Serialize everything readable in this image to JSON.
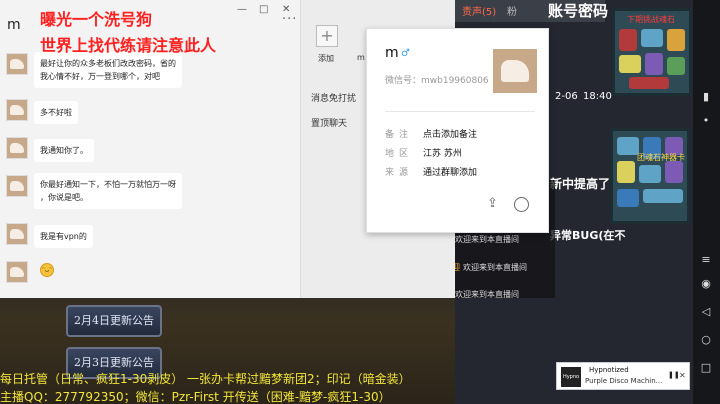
{
  "overlay": {
    "line1": "曝光一个洗号狗",
    "line2": "世界上找代练请注意此人"
  },
  "chat": {
    "contact_name": "m",
    "window_controls": [
      "—",
      "□",
      "✕"
    ],
    "more": "···",
    "messages": [
      {
        "lines": [
          "最好让你的众多老板们改改密码，省的",
          "我心情不好，万一登到哪个，对吧"
        ]
      },
      {
        "lines": [
          "多不好啦"
        ]
      },
      {
        "lines": [
          "我通知你了。"
        ]
      },
      {
        "lines": [
          "你最好通知一下，不怕一万就怕万一呀",
          "，你说是吧。"
        ]
      },
      {
        "lines": [
          "我是有vpn的"
        ]
      }
    ],
    "emoji": "😄"
  },
  "side": {
    "add_label": "添加",
    "member_label": "m",
    "mute_label": "消息免打扰",
    "pin_label": "置顶聊天"
  },
  "profile": {
    "name": "m",
    "gender_icon": "male-icon",
    "wechat_id": "微信号：mwb19960806",
    "rows": [
      {
        "key": "备注",
        "value": "点击添加备注"
      },
      {
        "key": "地区",
        "value": "江苏 苏州"
      },
      {
        "key": "来源",
        "value": "通过群聊添加"
      }
    ]
  },
  "game": {
    "tab_active": "责声(5)",
    "tab_other": "粉",
    "password_title": "账号密码",
    "date_a": "2-06",
    "date_b": "18:40",
    "text_a": "新中提高了",
    "text_b": "异常BUG(在不",
    "chat_lines": [
      "欢迎来到本直播间",
      "欢迎来到本直播间",
      "欢迎来到本直播间",
      "欢迎来到本直播间"
    ],
    "chat_highlight": "迎",
    "puzzle1_label": "下期挑战魂石",
    "puzzle2_label": "团魂石神器卡",
    "announce1": "2月4日更新公告",
    "announce2": "2月3日更新公告"
  },
  "ticker": {
    "line1": "每日托管（日常、疯狂1-30剥皮）  一张办卡帮过黯梦新团2；印记（暗金装）",
    "line2": "主播QQ：277792350；微信：Pzr-First  开传送（困难-黯梦-疯狂1-30）"
  },
  "music": {
    "title": "Hypnotized",
    "subtitle": "Purple Disco Machin...",
    "cover_text": "Hypno",
    "pause": "❚❚",
    "close": "✕"
  }
}
